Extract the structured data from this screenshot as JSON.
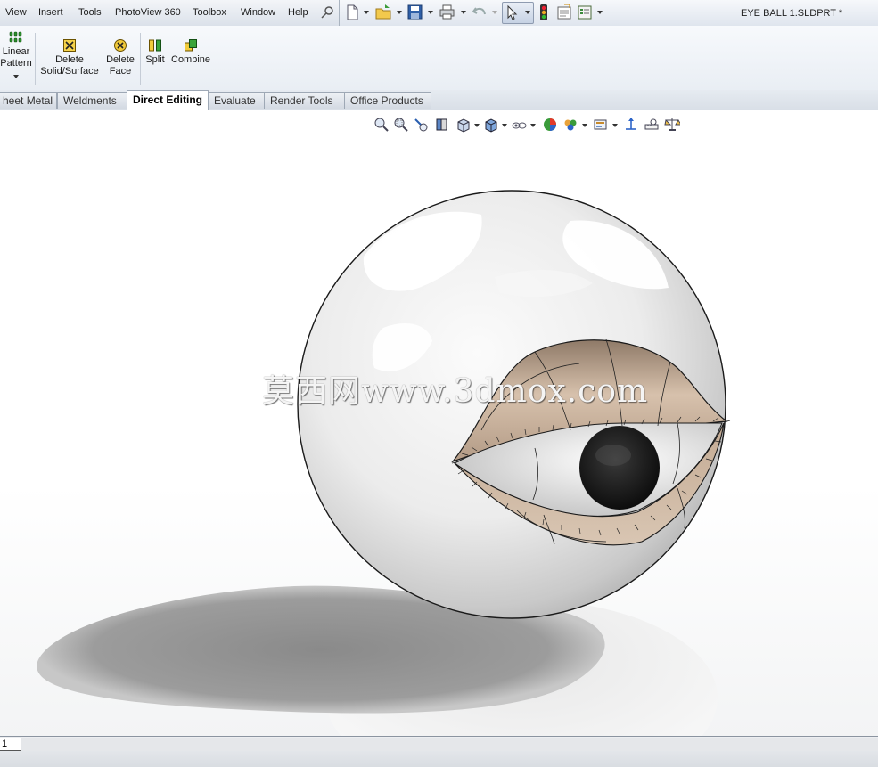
{
  "menubar": {
    "items": [
      "View",
      "Insert",
      "Tools",
      "PhotoView 360",
      "Toolbox",
      "Window",
      "Help"
    ],
    "document_title": "EYE BALL 1.SLDPRT *"
  },
  "quick_tools": [
    "new-document-icon",
    "open-folder-icon",
    "save-icon",
    "print-icon",
    "undo-icon",
    "select-pointer-icon",
    "rebuild-traffic-light-icon",
    "file-properties-icon",
    "options-icon"
  ],
  "command_manager": {
    "linear_pattern": {
      "line1": "Linear",
      "line2": "Pattern"
    },
    "delete_solid": {
      "line1": "Delete",
      "line2": "Solid/Surface"
    },
    "delete_face": {
      "line1": "Delete",
      "line2": "Face"
    },
    "split": "Split",
    "combine": "Combine"
  },
  "tabs": [
    "heet Metal",
    "Weldments",
    "Direct Editing",
    "Evaluate",
    "Render Tools",
    "Office Products"
  ],
  "active_tab": "Direct Editing",
  "headsup_toolbar": [
    "zoom-to-fit-icon",
    "zoom-to-area-icon",
    "previous-view-icon",
    "section-view-icon",
    "view-orientation-icon",
    "display-style-icon",
    "hide-show-items-icon",
    "edit-appearance-icon",
    "apply-scene-icon",
    "view-settings-icon",
    "triad-icon",
    "measure-icon",
    "mass-properties-icon"
  ],
  "watermark": "莫西网www.3dmox.com",
  "status": {
    "sheet_tab": "1"
  },
  "colors": {
    "eye_tan": "#c7ae97",
    "pupil": "#141414",
    "sphere_edge": "#1a1a1a",
    "tab_border": "#9ea8b5"
  }
}
